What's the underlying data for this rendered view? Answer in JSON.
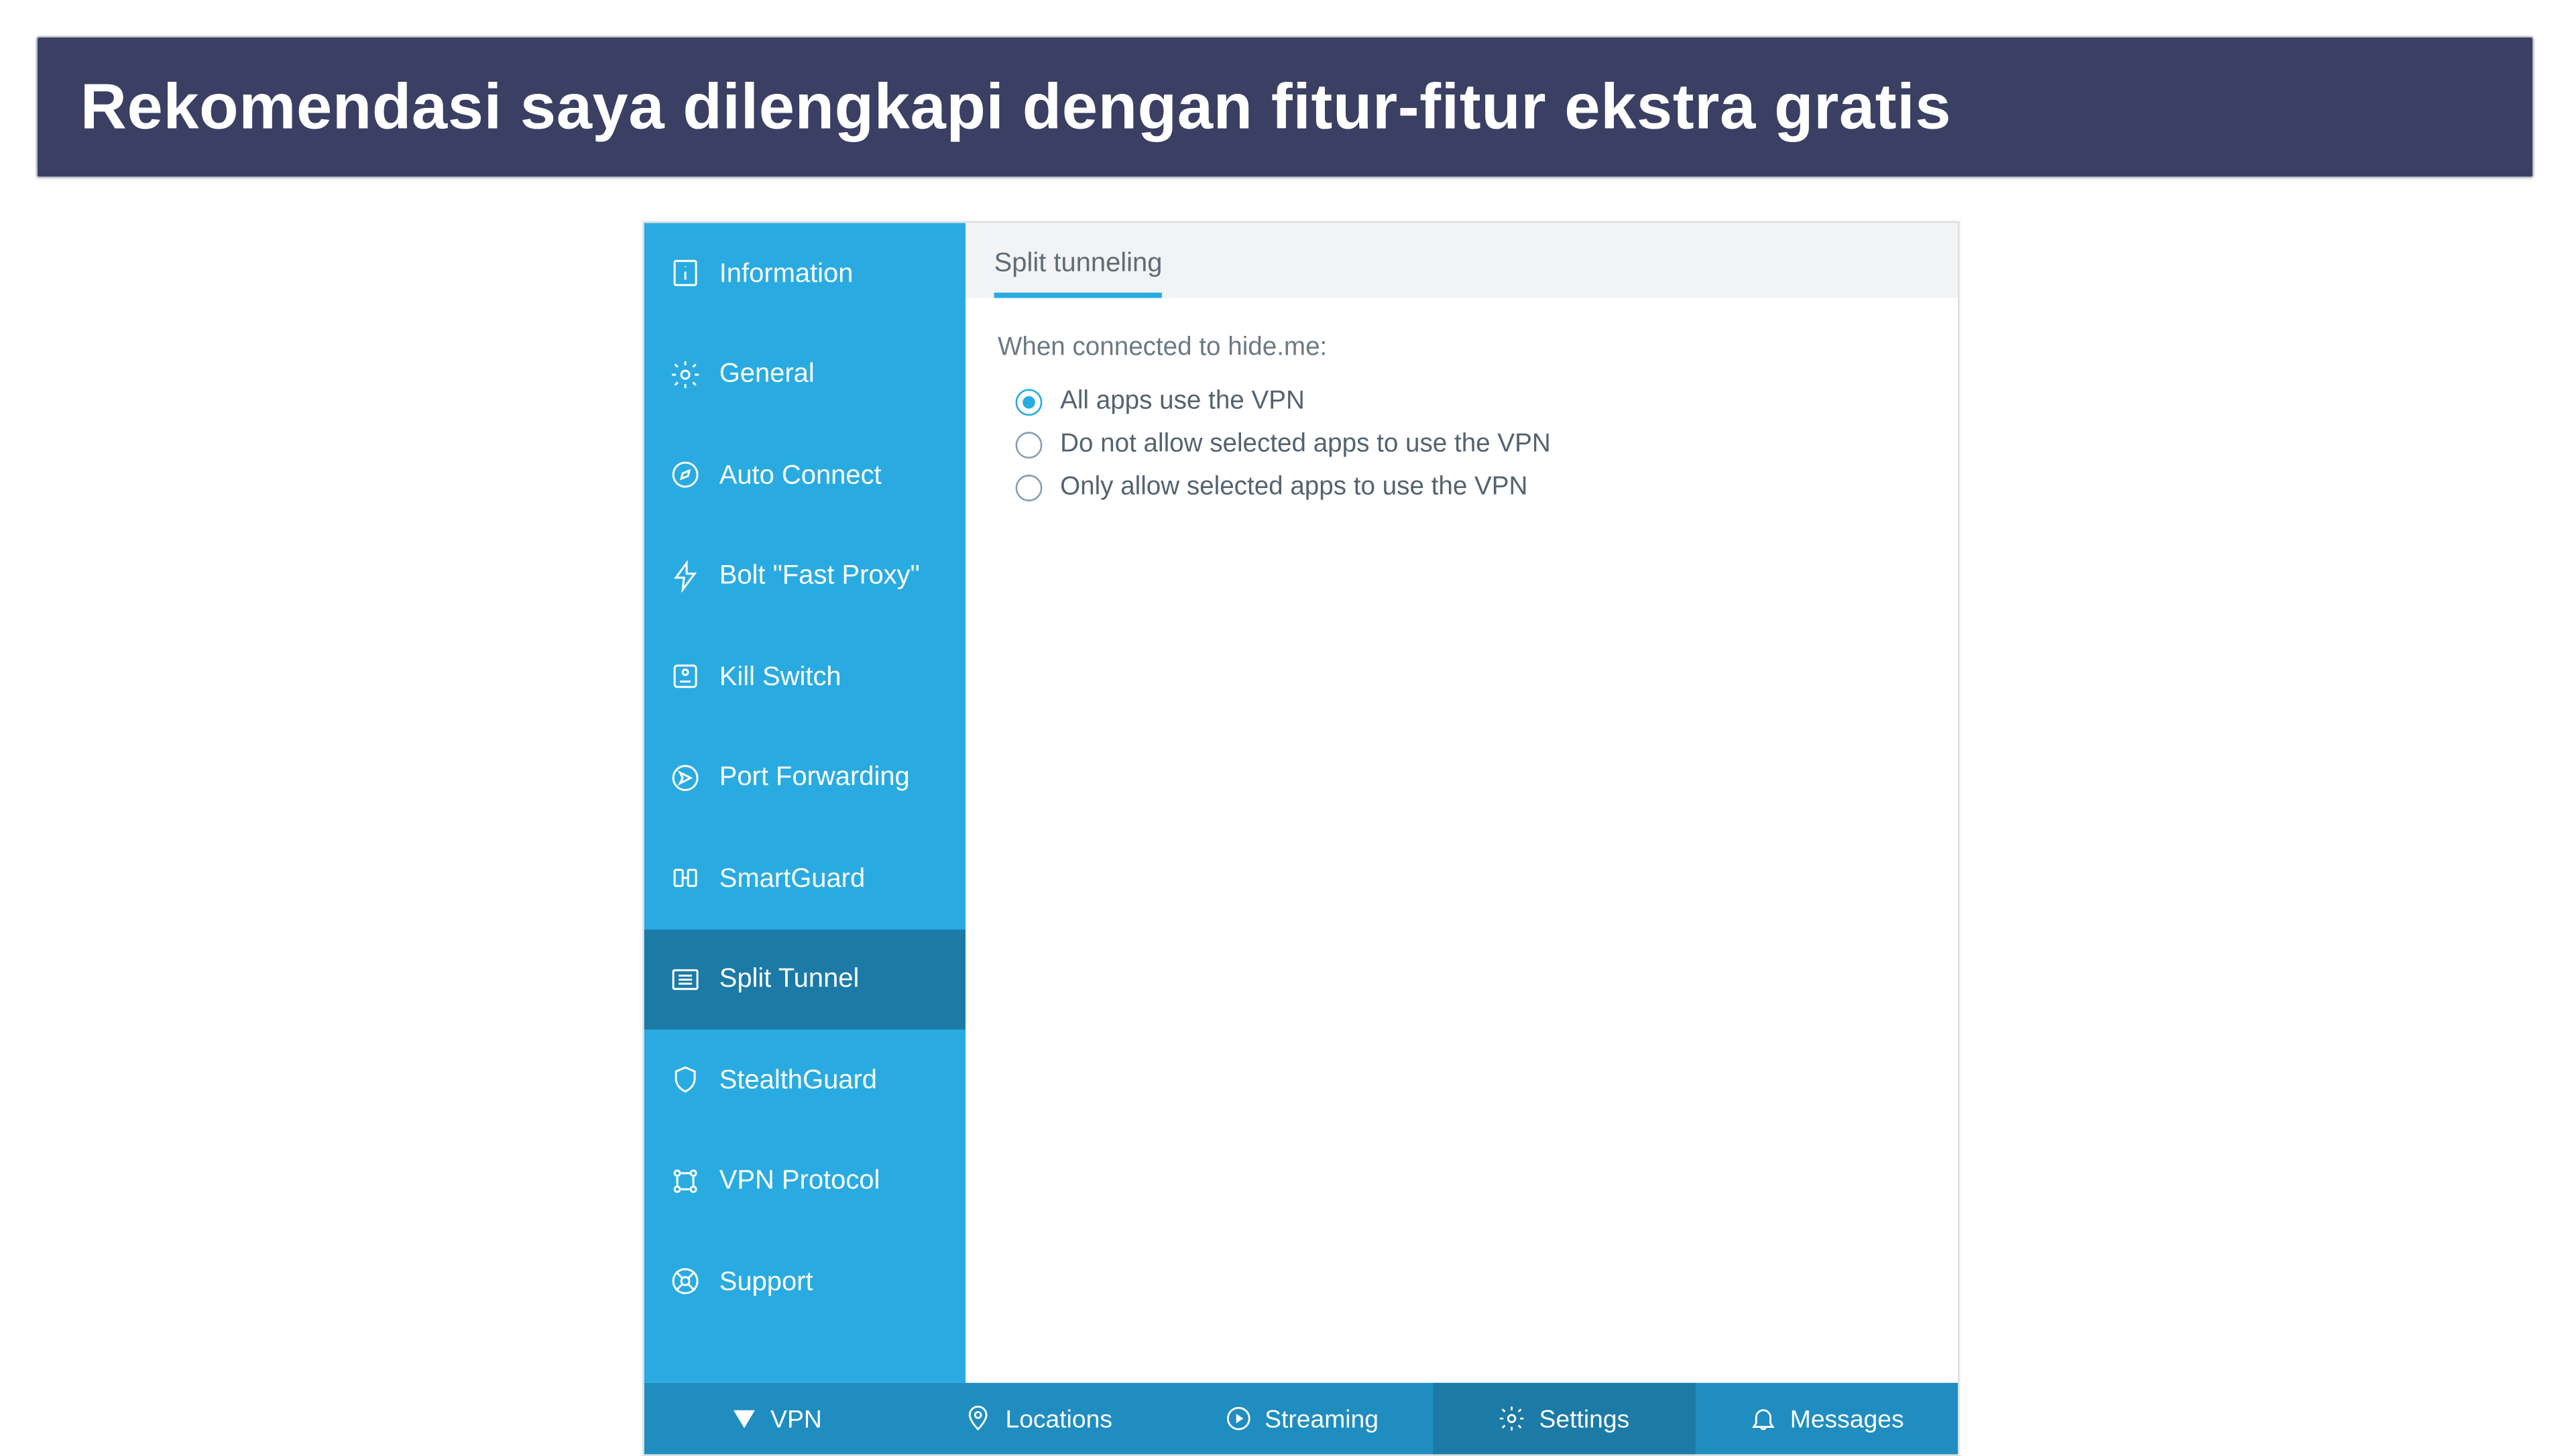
{
  "banner": {
    "text": "Rekomendasi saya dilengkapi dengan fitur-fitur ekstra gratis"
  },
  "sidebar": {
    "items": [
      {
        "label": "Information",
        "icon": "info-icon",
        "active": false
      },
      {
        "label": "General",
        "icon": "gear-icon",
        "active": false
      },
      {
        "label": "Auto Connect",
        "icon": "compass-icon",
        "active": false
      },
      {
        "label": "Bolt \"Fast Proxy\"",
        "icon": "bolt-icon",
        "active": false
      },
      {
        "label": "Kill Switch",
        "icon": "switch-icon",
        "active": false
      },
      {
        "label": "Port Forwarding",
        "icon": "forward-icon",
        "active": false
      },
      {
        "label": "SmartGuard",
        "icon": "smartguard-icon",
        "active": false
      },
      {
        "label": "Split Tunnel",
        "icon": "split-tunnel-icon",
        "active": true
      },
      {
        "label": "StealthGuard",
        "icon": "shield-icon",
        "active": false
      },
      {
        "label": "VPN Protocol",
        "icon": "protocol-icon",
        "active": false
      },
      {
        "label": "Support",
        "icon": "support-icon",
        "active": false
      }
    ]
  },
  "content": {
    "tab_label": "Split tunneling",
    "prompt": "When connected to hide.me:",
    "options": [
      {
        "label": "All apps use the VPN",
        "selected": true
      },
      {
        "label": "Do not allow selected apps to use the VPN",
        "selected": false
      },
      {
        "label": "Only allow selected apps to use the VPN",
        "selected": false
      }
    ]
  },
  "bottom_nav": {
    "items": [
      {
        "label": "VPN",
        "icon": "vpn-icon",
        "active": false
      },
      {
        "label": "Locations",
        "icon": "pin-icon",
        "active": false
      },
      {
        "label": "Streaming",
        "icon": "play-icon",
        "active": false
      },
      {
        "label": "Settings",
        "icon": "cog-icon",
        "active": true
      },
      {
        "label": "Messages",
        "icon": "bell-icon",
        "active": false
      }
    ]
  },
  "colors": {
    "brand": "#29abe2",
    "brand_dark": "#1b7aa6",
    "banner_bg": "#3a3f63",
    "nav_bg": "#1f8dc0"
  }
}
